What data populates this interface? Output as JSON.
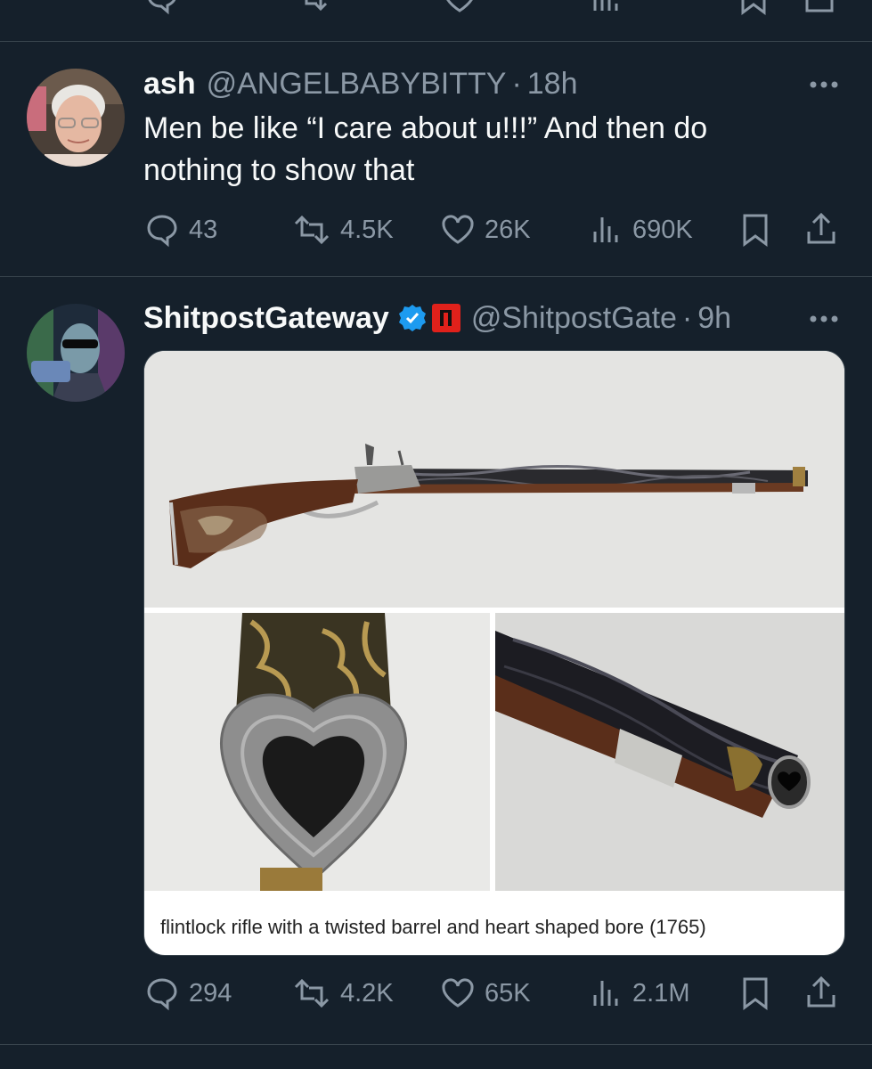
{
  "tweets": [
    {
      "display_name": "ash",
      "handle": "@ANGELBABYBITTY",
      "time": "18h",
      "text_line1": "Men be like “I care about u!!!” And then do",
      "text_line2": "nothing to show that",
      "replies": "43",
      "retweets": "4.5K",
      "likes": "26K",
      "views": "690K"
    },
    {
      "display_name": "ShitpostGateway",
      "handle": "@ShitpostGate",
      "time": "9h",
      "verified": true,
      "affiliate_badge": "red-square-icon",
      "media_caption": "flintlock rifle with a twisted barrel and heart shaped bore (1765)",
      "replies": "294",
      "retweets": "4.2K",
      "likes": "65K",
      "views": "2.1M"
    }
  ],
  "colors": {
    "background": "#15202b",
    "divider": "#38444d",
    "secondary_text": "#8b98a5",
    "verified_blue": "#1d9bf0",
    "affiliate_red": "#e0211b"
  }
}
